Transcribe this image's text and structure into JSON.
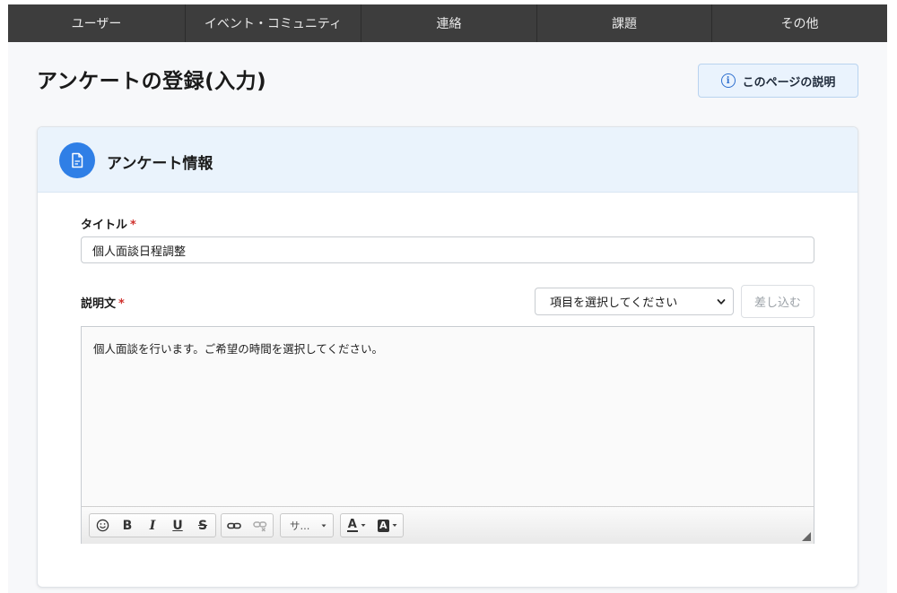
{
  "nav": {
    "items": [
      {
        "label": "ユーザー"
      },
      {
        "label": "イベント・コミュニティ"
      },
      {
        "label": "連絡"
      },
      {
        "label": "課題"
      },
      {
        "label": "その他"
      }
    ]
  },
  "header": {
    "page_title": "アンケートの登録(入力)",
    "help_button_label": "このページの説明"
  },
  "card": {
    "title": "アンケート情報"
  },
  "form": {
    "title_label": "タイトル",
    "title_value": "個人面談日程調整",
    "description_label": "説明文",
    "required_mark": "*",
    "select_value": "項目を選択してください",
    "insert_button_label": "差し込む",
    "description_text": "個人面談を行います。ご希望の時間を選択してください。"
  },
  "toolbar": {
    "bold": "B",
    "italic": "I",
    "underline": "U",
    "strike": "S",
    "size_label": "サ...",
    "font_color": "A",
    "bg_color": "A"
  },
  "colors": {
    "nav_bg": "#3d3d3d",
    "accent": "#2f7fe6",
    "required": "#d0312d"
  }
}
